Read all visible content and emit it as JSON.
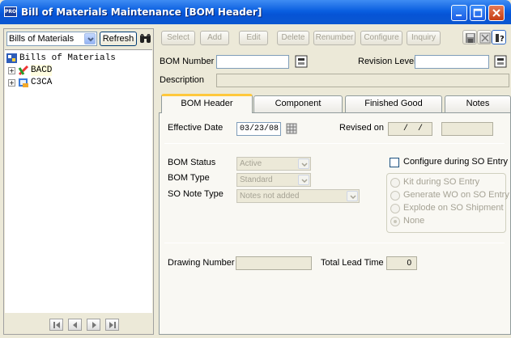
{
  "window": {
    "title": "Bill of Materials Maintenance [BOM Header]",
    "app_icon_text": "PRO"
  },
  "left": {
    "combo_value": "Bills of Materials",
    "refresh_label": "Refresh",
    "tree_root": "Bills of Materials",
    "tree_items": [
      {
        "label": "BACD",
        "selected": true
      },
      {
        "label": "C3CA",
        "selected": false
      }
    ]
  },
  "toolbar": {
    "select": "Select",
    "add": "Add",
    "edit": "Edit",
    "delete": "Delete",
    "renumber": "Renumber",
    "configure": "Configure",
    "inquiry": "Inquiry"
  },
  "header": {
    "bom_number_label": "BOM Number",
    "bom_number_value": "",
    "revision_label": "Revision Level",
    "revision_value": "",
    "description_label": "Description",
    "description_value": ""
  },
  "tabs": [
    {
      "label": "BOM Header",
      "active": true
    },
    {
      "label": "Component",
      "active": false
    },
    {
      "label": "Finished Good",
      "active": false
    },
    {
      "label": "Notes",
      "active": false
    }
  ],
  "form": {
    "effective_date_label": "Effective Date",
    "effective_date_value": "03/23/08",
    "revised_on_label": "Revised on",
    "revised_on_value": " /  / ",
    "bom_status_label": "BOM Status",
    "bom_status_value": "Active",
    "bom_type_label": "BOM Type",
    "bom_type_value": "Standard",
    "so_note_type_label": "SO Note Type",
    "so_note_type_value": "Notes not added",
    "configure_label": "Configure during SO Entry",
    "radio_options": [
      {
        "label": "Kit during SO Entry",
        "selected": false
      },
      {
        "label": "Generate WO on SO Entry",
        "selected": false
      },
      {
        "label": "Explode on SO Shipment",
        "selected": false
      },
      {
        "label": "None",
        "selected": true
      }
    ],
    "drawing_number_label": "Drawing Number",
    "drawing_number_value": "",
    "total_lead_time_label": "Total Lead Time",
    "total_lead_time_value": "0"
  }
}
